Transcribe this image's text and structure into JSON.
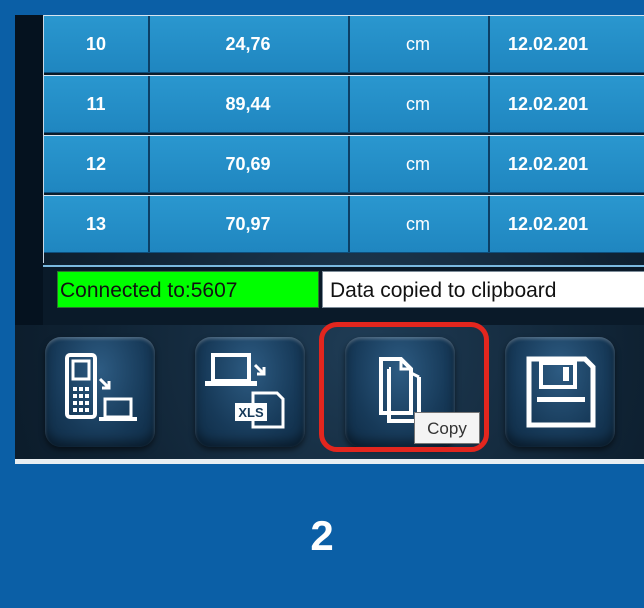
{
  "table": {
    "rows": [
      {
        "id": "10",
        "value": "24,76",
        "unit": "cm",
        "date": "12.02.201"
      },
      {
        "id": "11",
        "value": "89,44",
        "unit": "cm",
        "date": "12.02.201"
      },
      {
        "id": "12",
        "value": "70,69",
        "unit": "cm",
        "date": "12.02.201"
      },
      {
        "id": "13",
        "value": "70,97",
        "unit": "cm",
        "date": "12.02.201"
      }
    ]
  },
  "status": {
    "connection": "Connected to:5607",
    "message": "Data copied to clipboard"
  },
  "toolbar": {
    "buttons": [
      {
        "icon": "device-to-laptop-icon"
      },
      {
        "icon": "laptop-to-xls-icon",
        "badge": "XLS"
      },
      {
        "icon": "copy-icon"
      },
      {
        "icon": "save-icon"
      }
    ],
    "copy_tooltip": "Copy"
  },
  "step_label": "2",
  "colors": {
    "background": "#0b5fa6",
    "row": "#2a97cf",
    "connected": "#00ff00",
    "highlight": "#e3261e"
  }
}
